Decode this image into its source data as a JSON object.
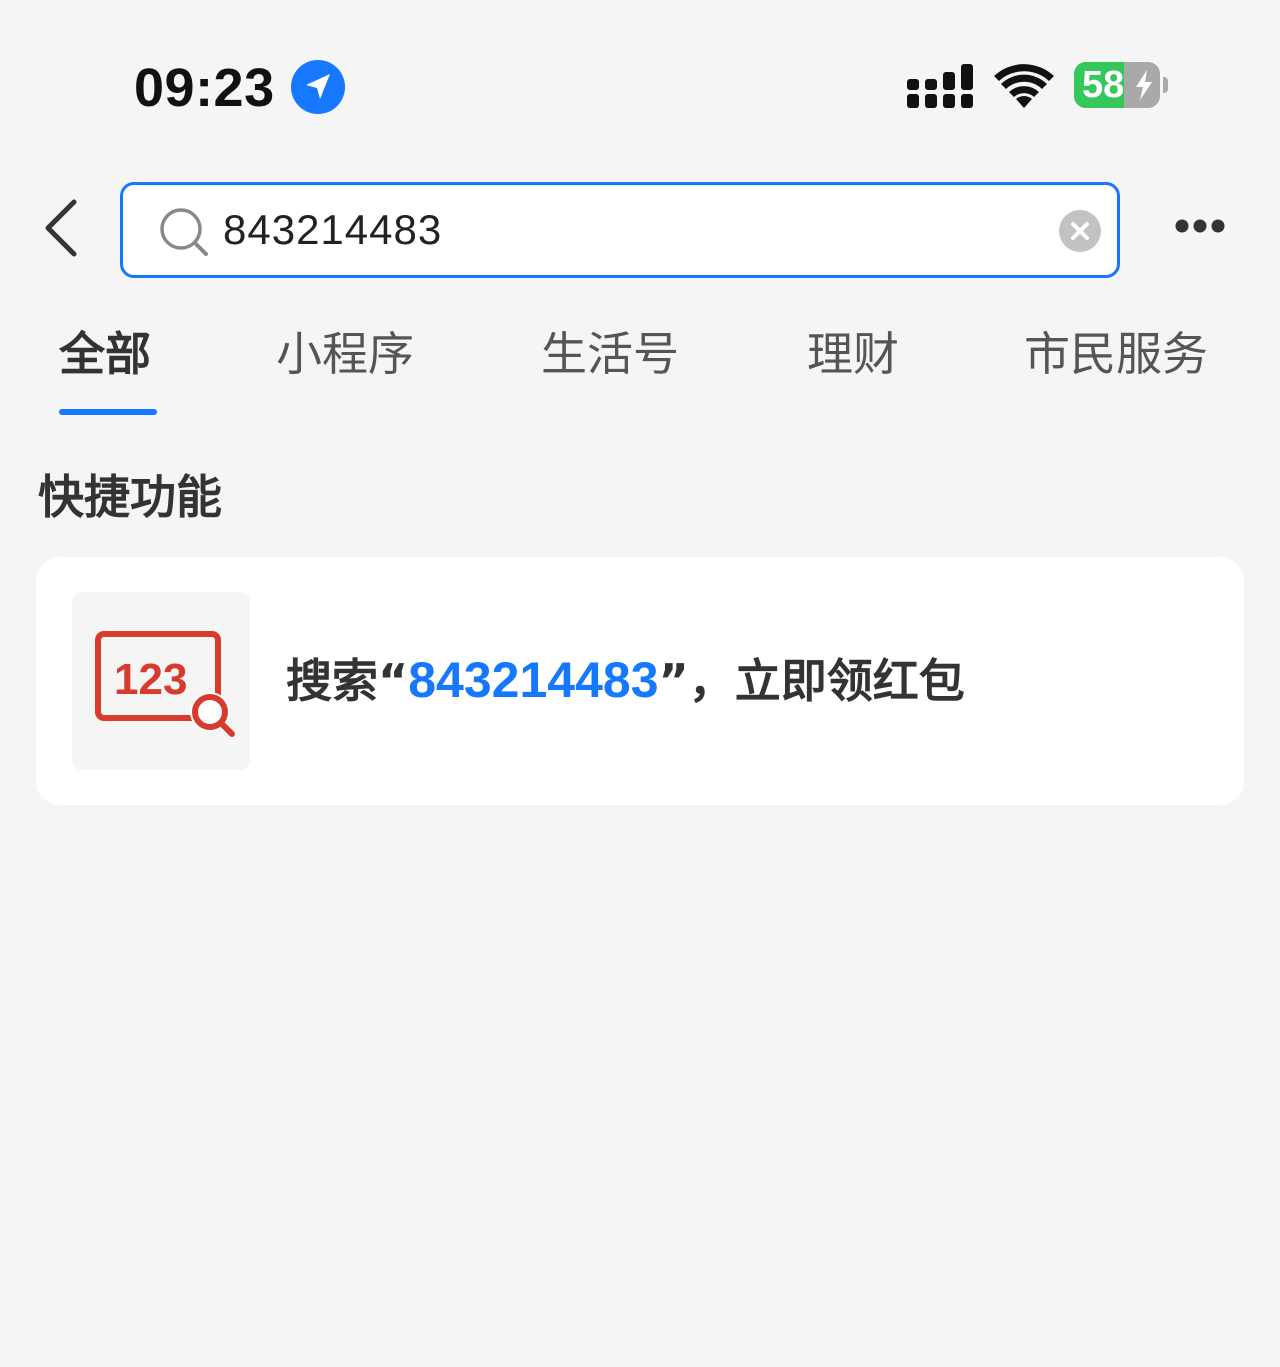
{
  "status_bar": {
    "time": "09:23",
    "battery_level": "58",
    "battery_percent": 58,
    "icons": [
      "location-arrow-icon",
      "cellular-signal-icon",
      "wifi-icon",
      "battery-charging-icon"
    ]
  },
  "search": {
    "value": "843214483",
    "icons": [
      "back-arrow-icon",
      "search-icon",
      "clear-icon",
      "more-dots-icon"
    ]
  },
  "tabs": [
    {
      "label": "全部",
      "active": true
    },
    {
      "label": "小程序",
      "active": false
    },
    {
      "label": "生活号",
      "active": false
    },
    {
      "label": "理财",
      "active": false
    },
    {
      "label": "市民服务",
      "active": false
    }
  ],
  "quick_functions": {
    "title": "快捷功能",
    "card": {
      "icon": "number-search-icon",
      "icon_text": "123",
      "prefix": "搜索“",
      "keyword": "843214483",
      "suffix": "”，立即领红包"
    }
  },
  "colors": {
    "accent": "#1677ff",
    "background": "#f5f5f5",
    "card": "#ffffff",
    "icon_red": "#d83a2e",
    "battery_green": "#34c759"
  }
}
